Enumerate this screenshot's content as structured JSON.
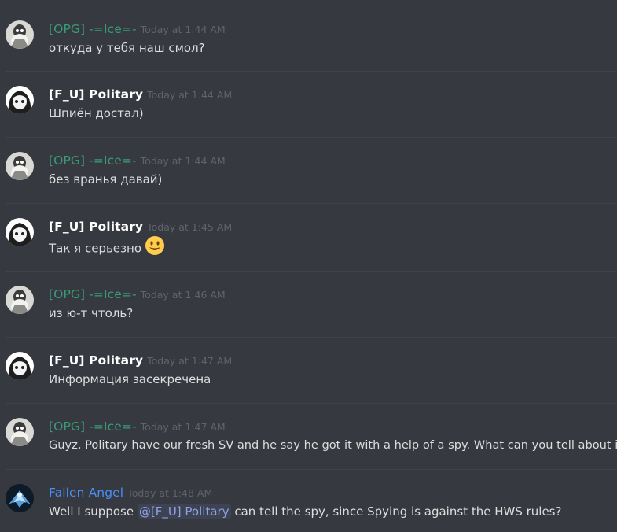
{
  "colors": {
    "background": "#36393f",
    "ice_name": "#3a9b76",
    "politary_name": "#ffffff",
    "fallen_name": "#4a8ef2",
    "timestamp": "#5f646c",
    "text": "#dcddde",
    "mention_text": "#8ea1e1"
  },
  "messages": [
    {
      "author": "[OPG] -=Ice=-",
      "time": "Today at 1:44 AM",
      "text": "откуда у тебя наш смол?",
      "avatar": "ice-avatar"
    },
    {
      "author": "[F_U] Politary",
      "time": "Today at 1:44 AM",
      "text": "Шпиён достал)",
      "avatar": "politary-avatar"
    },
    {
      "author": "[OPG] -=Ice=-",
      "time": "Today at 1:44 AM",
      "text": "без вранья давай)",
      "avatar": "ice-avatar"
    },
    {
      "author": "[F_U] Politary",
      "time": "Today at 1:45 AM",
      "text": "Так я серьезно",
      "emoji": "smiley-emoji",
      "avatar": "politary-avatar"
    },
    {
      "author": "[OPG] -=Ice=-",
      "time": "Today at 1:46 AM",
      "text": "из ю-т чтоль?",
      "avatar": "ice-avatar"
    },
    {
      "author": "[F_U] Politary",
      "time": "Today at 1:47 AM",
      "text": "Информация засекречена",
      "avatar": "politary-avatar"
    },
    {
      "author": "[OPG] -=Ice=-",
      "time": "Today at 1:47 AM",
      "text": "Guyz, Politary have our fresh SV and he say he got it with a help of a spy. What can you tell about it?",
      "avatar": "ice-avatar"
    },
    {
      "author": "Fallen Angel",
      "time": "Today at 1:48 AM",
      "text_before": "Well I suppose ",
      "mention": "@[F_U] Politary",
      "text_after": " can tell the spy, since Spying is against the HWS rules?",
      "avatar": "fallen-angel-avatar"
    }
  ]
}
